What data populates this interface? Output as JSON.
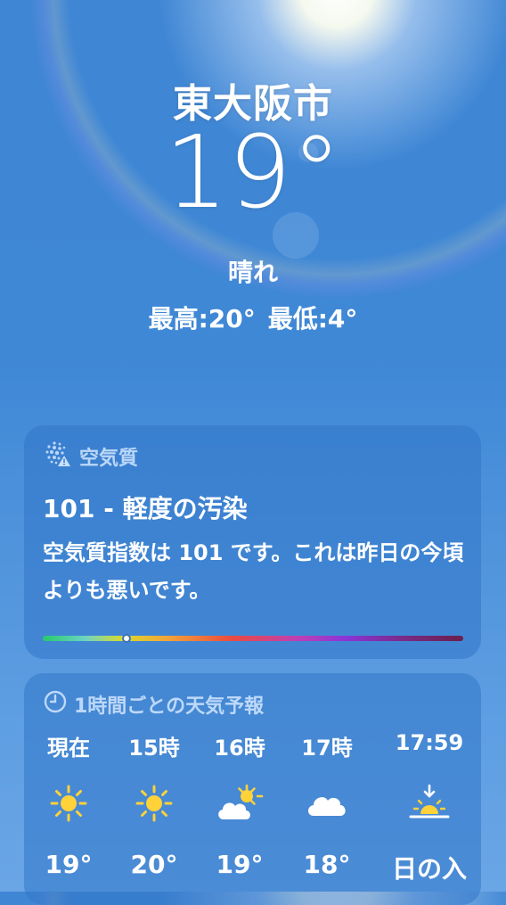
{
  "location": {
    "city": "東大阪市",
    "temperature": "19°",
    "condition": "晴れ",
    "high": "最高:20°",
    "low": "最低:4°"
  },
  "air_quality": {
    "header": "空気質",
    "header_icon": "air-quality-icon",
    "value": "101 - 軽度の汚染",
    "description": "空気質指数は 101 です。これは昨日の今頃よりも悪いです。",
    "scale_position": 0.2
  },
  "hourly": {
    "header": "1時間ごとの天気予報",
    "header_icon": "clock-icon",
    "items": [
      {
        "time": "現在",
        "icon": "sun-icon",
        "temp": "19°"
      },
      {
        "time": "15時",
        "icon": "sun-icon",
        "temp": "20°"
      },
      {
        "time": "16時",
        "icon": "partly-cloudy-icon",
        "temp": "19°"
      },
      {
        "time": "17時",
        "icon": "cloud-icon",
        "temp": "18°"
      },
      {
        "time": "17:59",
        "icon": "sunset-icon",
        "temp": "日の入"
      }
    ]
  },
  "colors": {
    "sky_top": "#3f86d4",
    "sky_bottom": "#6aa6e6",
    "sun": "#ffd23a",
    "card": "#3276c8"
  }
}
